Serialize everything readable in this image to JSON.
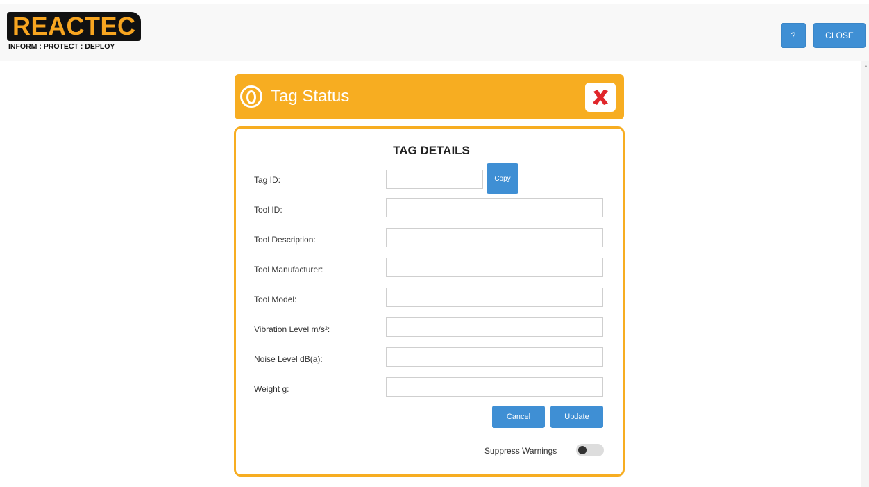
{
  "header": {
    "logo_text": "REACTEC",
    "logo_tagline": "INFORM : PROTECT : DEPLOY",
    "help_label": "?",
    "close_label": "CLOSE"
  },
  "panel": {
    "title": "Tag Status",
    "section_title": "TAG DETAILS",
    "copy_label": "Copy",
    "fields": [
      {
        "label": "Tag ID:",
        "value": ""
      },
      {
        "label": "Tool ID:",
        "value": ""
      },
      {
        "label": "Tool Description:",
        "value": ""
      },
      {
        "label": "Tool Manufacturer:",
        "value": ""
      },
      {
        "label": "Tool Model:",
        "value": ""
      },
      {
        "label": "Vibration Level m/s²:",
        "value": ""
      },
      {
        "label": "Noise Level dB(a):",
        "value": ""
      },
      {
        "label": "Weight g:",
        "value": ""
      }
    ],
    "cancel_label": "Cancel",
    "update_label": "Update",
    "suppress_label": "Suppress Warnings",
    "suppress_on": false
  },
  "colors": {
    "brand_orange": "#f7ad21",
    "button_blue": "#3f8fd4",
    "close_x_red": "#e0262b"
  },
  "icons": {
    "panel": "tag-icon",
    "dismiss": "close-x-icon",
    "scroll_up": "scroll-up-arrow-icon"
  }
}
